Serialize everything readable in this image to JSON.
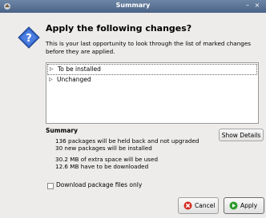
{
  "window": {
    "title": "Summary",
    "minimize_glyph": "–",
    "close_glyph": "×"
  },
  "dialog": {
    "heading": "Apply the following changes?",
    "description": "This is your last opportunity to look through the list of marked changes before they are applied."
  },
  "changes_tree": {
    "items": [
      {
        "label": "To be installed",
        "expanded": false
      },
      {
        "label": "Unchanged",
        "expanded": false
      }
    ],
    "expander_glyph": "▷"
  },
  "summary": {
    "title": "Summary",
    "show_details_label": "Show Details",
    "lines": [
      "136 packages will be held back and not upgraded",
      "30 new packages will be installed",
      "30.2 MB of extra space will be used",
      "12.6 MB have to be downloaded"
    ]
  },
  "download_only": {
    "label": "Download package files only",
    "checked": false
  },
  "buttons": {
    "cancel_label": "Cancel",
    "apply_label": "Apply"
  },
  "icons": {
    "app": "app-icon",
    "question": "question-icon",
    "cancel": "cancel-icon",
    "apply": "apply-icon"
  },
  "colors": {
    "titlebar": "#5a7397",
    "question_icon": "#3366cc",
    "cancel_icon": "#d42b1e",
    "apply_icon": "#2d9b2d"
  }
}
